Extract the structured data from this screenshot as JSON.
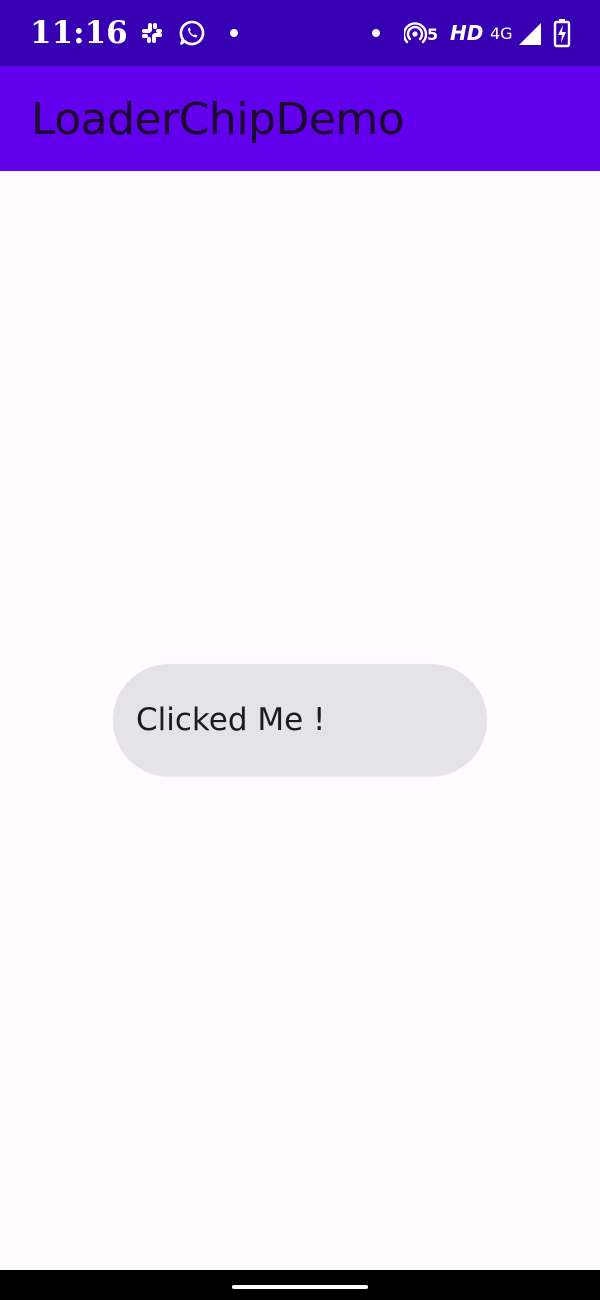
{
  "status_bar": {
    "time": "11:16",
    "notification_icons": [
      "slack-icon",
      "whatsapp-icon",
      "notification-dot-icon"
    ],
    "system_icons": [
      "notification-dot-icon",
      "hotspot-icon",
      "hd-icon",
      "network-4g-icon",
      "signal-icon",
      "battery-charging-icon"
    ],
    "hotspot_count": "5",
    "hd_label": "HD",
    "network_label": "4G",
    "background_color": "#3700B3"
  },
  "app_bar": {
    "title": "LoaderChipDemo",
    "background_color": "#6200EE"
  },
  "main": {
    "chip": {
      "label": "Clicked Me !",
      "background_color": "#E4E3E7"
    }
  },
  "nav_bar": {
    "background_color": "#000000"
  }
}
